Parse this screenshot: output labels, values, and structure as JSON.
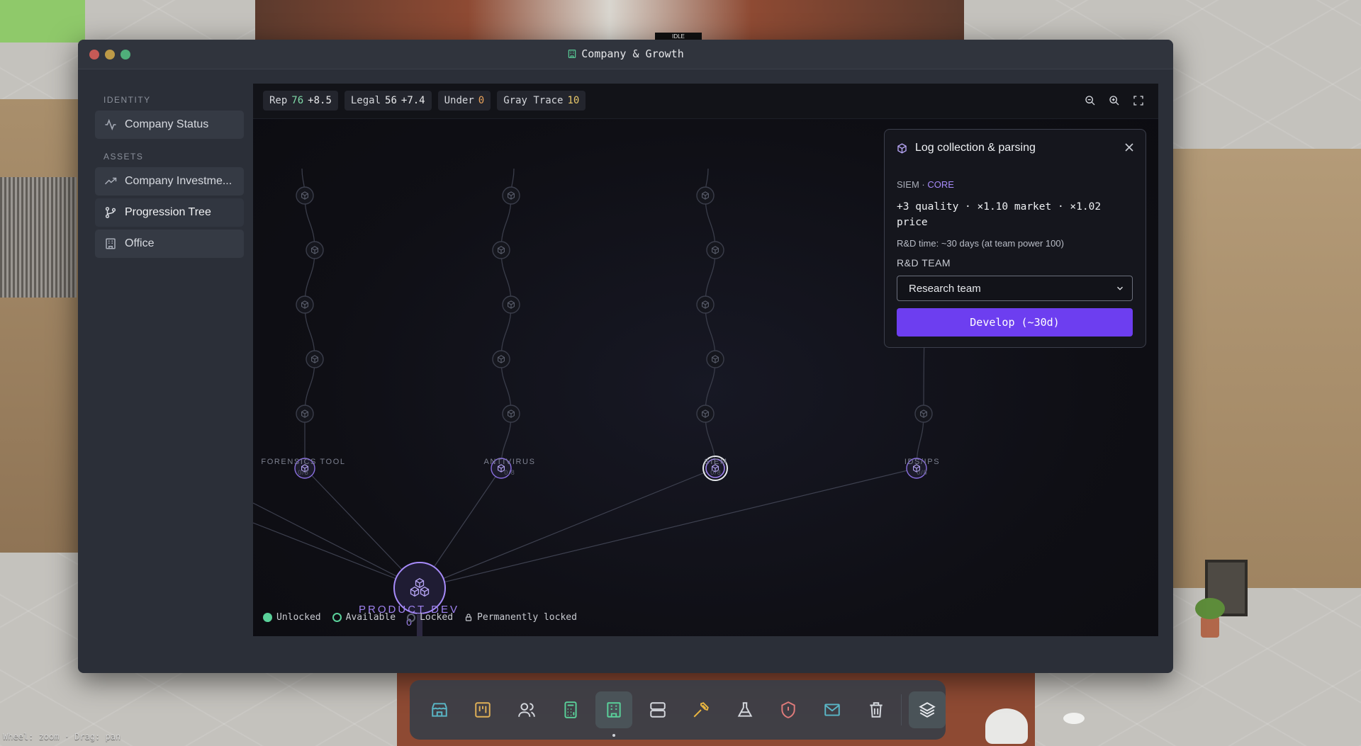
{
  "world": {
    "status_tag": "IDLE",
    "hint": "Wheel: zoom · Drag: pan"
  },
  "window": {
    "title": "Company & Growth"
  },
  "sidebar": {
    "sections": [
      {
        "label": "IDENTITY",
        "items": [
          {
            "label": "Company Status",
            "icon": "activity-icon"
          }
        ]
      },
      {
        "label": "ASSETS",
        "items": [
          {
            "label": "Company Investme...",
            "icon": "trending-up-icon"
          },
          {
            "label": "Progression Tree",
            "icon": "git-branch-icon"
          },
          {
            "label": "Office",
            "icon": "building-icon"
          }
        ]
      }
    ]
  },
  "stats": {
    "rep": {
      "label": "Rep",
      "value": "76",
      "delta": "+8.5"
    },
    "legal": {
      "label": "Legal",
      "value": "56",
      "delta": "+7.4"
    },
    "under": {
      "label": "Under",
      "value": "0"
    },
    "gray_trace": {
      "label": "Gray Trace",
      "value": "10"
    }
  },
  "tree": {
    "root": {
      "label": "PRODUCT DEV",
      "count": "0"
    },
    "branches": [
      {
        "label": "FORENSICS TOOL",
        "progress": "0/8"
      },
      {
        "label": "ANTIVIRUS",
        "progress": "0/8"
      },
      {
        "label": "SIEM",
        "progress": "0/8"
      },
      {
        "label": "IDS/IPS",
        "progress": "0/8"
      }
    ]
  },
  "legend": {
    "unlocked": "Unlocked",
    "available": "Available",
    "locked": "Locked",
    "perm_locked": "Permanently locked"
  },
  "panel": {
    "title": "Log collection & parsing",
    "category": "SIEM · ",
    "tier": "CORE",
    "effects": "+3 quality · ×1.10 market · ×1.02 price",
    "rd_time": "R&D time: ~30 days (at team power 100)",
    "team_label": "R&D TEAM",
    "team_selected": "Research team",
    "develop_label": "Develop (~30d)"
  },
  "dock": {
    "tools": [
      "shop-icon",
      "kanban-icon",
      "users-icon",
      "calculator-icon",
      "company-icon",
      "server-icon",
      "hammer-icon",
      "flask-icon",
      "shield-alert-icon",
      "mail-icon",
      "trash-icon",
      "layers-icon"
    ],
    "active": "company-icon"
  },
  "colors": {
    "accent": "#6d3ef0",
    "unlocked": "#5ad19a",
    "node_purple": "#9f82ef",
    "warn": "#e9a25a",
    "gold": "#e8c86a"
  }
}
